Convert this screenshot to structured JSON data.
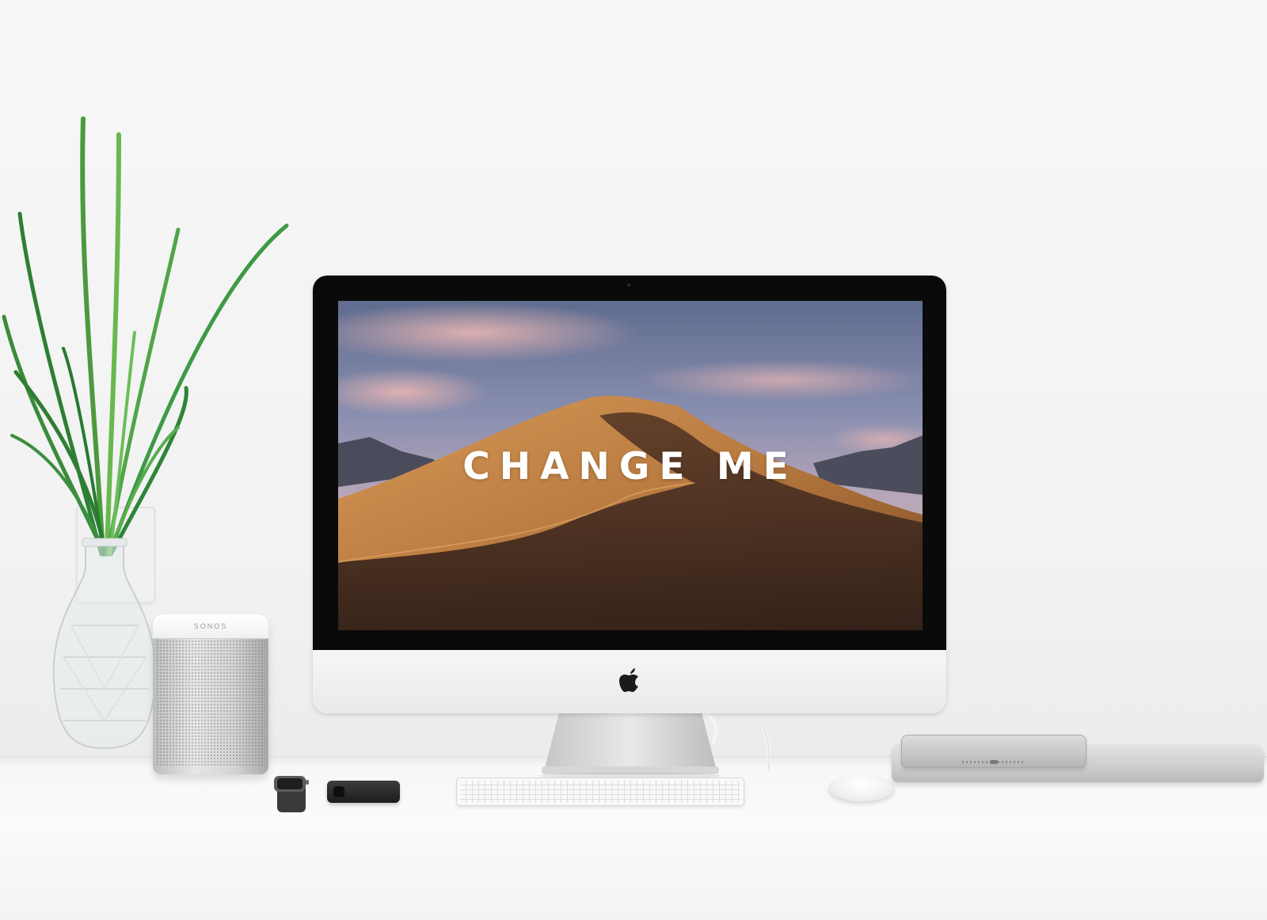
{
  "scene": "desk-setup",
  "screen": {
    "headline": "CHANGE ME"
  },
  "speaker": {
    "brand": "SONOS"
  },
  "colors": {
    "wall": "#f4f4f4",
    "bezel": "#0a0a0a",
    "dune": "#b9793e",
    "sky": "#6d7896",
    "plant": "#2f8f3c",
    "headline": "#ffffff"
  }
}
